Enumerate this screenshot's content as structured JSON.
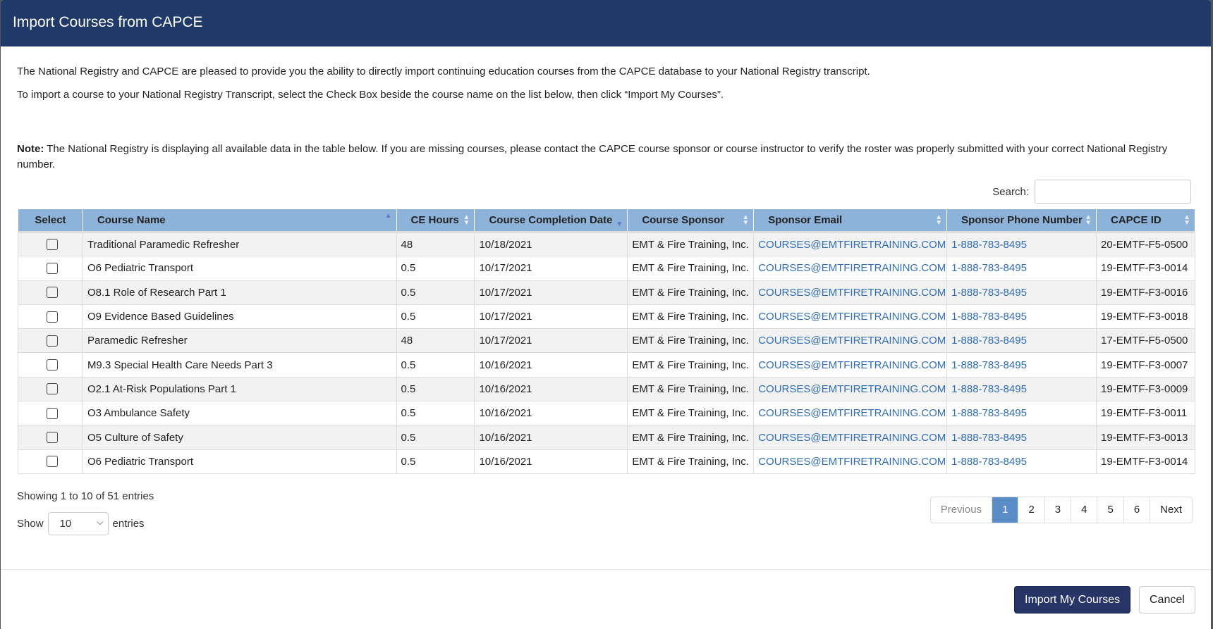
{
  "modal": {
    "title": "Import Courses from CAPCE",
    "intro1": "The National Registry and CAPCE are pleased to provide you the ability to directly import continuing education courses from the CAPCE database to your National Registry transcript.",
    "intro2": "To import a course to your National Registry Transcript, select the Check Box beside the course name on the list below, then click “Import My Courses”.",
    "note_label": "Note:",
    "note": " The National Registry is displaying all available data in the table below.  If you are missing courses, please contact the CAPCE course sponsor or course instructor to verify the roster was properly submitted with your correct National Registry number."
  },
  "search": {
    "label": "Search:",
    "value": ""
  },
  "table": {
    "columns": [
      "Select",
      "Course Name",
      "CE Hours",
      "Course Completion Date",
      "Course Sponsor",
      "Sponsor Email",
      "Sponsor Phone Number",
      "CAPCE ID"
    ],
    "rows": [
      [
        "Traditional Paramedic Refresher",
        "48",
        "10/18/2021",
        "EMT & Fire Training, Inc.",
        "COURSES@EMTFIRETRAINING.COM",
        "1-888-783-8495",
        "20-EMTF-F5-0500"
      ],
      [
        "O6 Pediatric Transport",
        "0.5",
        "10/17/2021",
        "EMT & Fire Training, Inc.",
        "COURSES@EMTFIRETRAINING.COM",
        "1-888-783-8495",
        "19-EMTF-F3-0014"
      ],
      [
        "O8.1 Role of Research Part 1",
        "0.5",
        "10/17/2021",
        "EMT & Fire Training, Inc.",
        "COURSES@EMTFIRETRAINING.COM",
        "1-888-783-8495",
        "19-EMTF-F3-0016"
      ],
      [
        "O9 Evidence Based Guidelines",
        "0.5",
        "10/17/2021",
        "EMT & Fire Training, Inc.",
        "COURSES@EMTFIRETRAINING.COM",
        "1-888-783-8495",
        "19-EMTF-F3-0018"
      ],
      [
        "Paramedic Refresher",
        "48",
        "10/17/2021",
        "EMT & Fire Training, Inc.",
        "COURSES@EMTFIRETRAINING.COM",
        "1-888-783-8495",
        "17-EMTF-F5-0500"
      ],
      [
        "M9.3 Special Health Care Needs Part 3",
        "0.5",
        "10/16/2021",
        "EMT & Fire Training, Inc.",
        "COURSES@EMTFIRETRAINING.COM",
        "1-888-783-8495",
        "19-EMTF-F3-0007"
      ],
      [
        "O2.1 At-Risk Populations Part 1",
        "0.5",
        "10/16/2021",
        "EMT & Fire Training, Inc.",
        "COURSES@EMTFIRETRAINING.COM",
        "1-888-783-8495",
        "19-EMTF-F3-0009"
      ],
      [
        "O3 Ambulance Safety",
        "0.5",
        "10/16/2021",
        "EMT & Fire Training, Inc.",
        "COURSES@EMTFIRETRAINING.COM",
        "1-888-783-8495",
        "19-EMTF-F3-0011"
      ],
      [
        "O5 Culture of Safety",
        "0.5",
        "10/16/2021",
        "EMT & Fire Training, Inc.",
        "COURSES@EMTFIRETRAINING.COM",
        "1-888-783-8495",
        "19-EMTF-F3-0013"
      ],
      [
        "O6 Pediatric Transport",
        "0.5",
        "10/16/2021",
        "EMT & Fire Training, Inc.",
        "COURSES@EMTFIRETRAINING.COM",
        "1-888-783-8495",
        "19-EMTF-F3-0014"
      ]
    ]
  },
  "info": "Showing 1 to 10 of 51 entries",
  "length": {
    "show": "Show",
    "value": "10",
    "entries": "entries"
  },
  "pagination": [
    "Previous",
    "1",
    "2",
    "3",
    "4",
    "5",
    "6",
    "Next"
  ],
  "buttons": {
    "import": "Import My Courses",
    "cancel": "Cancel"
  },
  "colors": {
    "header": "#1f3a68",
    "table_header": "#8db3da",
    "link": "#2f6db5",
    "active_page": "#5a8cc8",
    "primary_button": "#263466"
  }
}
